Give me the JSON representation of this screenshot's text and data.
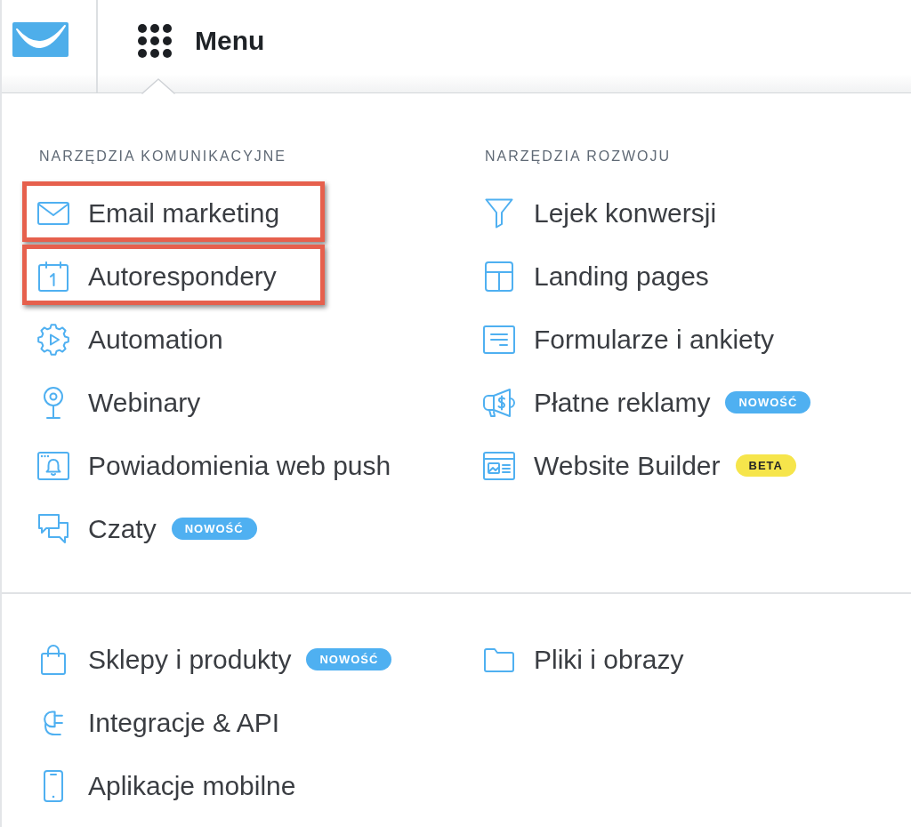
{
  "header": {
    "menu_label": "Menu"
  },
  "groups": [
    {
      "columns": [
        {
          "heading": "NARZĘDZIA KOMUNIKACYJNE",
          "items": [
            {
              "label": "Email marketing",
              "highlighted": true
            },
            {
              "label": "Autorespondery",
              "highlighted": true
            },
            {
              "label": "Automation",
              "highlighted": false
            },
            {
              "label": "Webinary",
              "highlighted": false
            },
            {
              "label": "Powiadomienia web push",
              "highlighted": false
            },
            {
              "label": "Czaty",
              "highlighted": false,
              "badge": {
                "text": "NOWOŚĆ",
                "kind": "new"
              }
            }
          ]
        },
        {
          "heading": "NARZĘDZIA ROZWOJU",
          "items": [
            {
              "label": "Lejek konwersji",
              "highlighted": false
            },
            {
              "label": "Landing pages",
              "highlighted": false
            },
            {
              "label": "Formularze i ankiety",
              "highlighted": false
            },
            {
              "label": "Płatne reklamy",
              "highlighted": false,
              "badge": {
                "text": "NOWOŚĆ",
                "kind": "new"
              }
            },
            {
              "label": "Website Builder",
              "highlighted": false,
              "badge": {
                "text": "BETA",
                "kind": "beta"
              }
            }
          ]
        }
      ]
    },
    {
      "columns": [
        {
          "items": [
            {
              "label": "Sklepy i produkty",
              "highlighted": false,
              "badge": {
                "text": "NOWOŚĆ",
                "kind": "new"
              }
            },
            {
              "label": "Integracje & API",
              "highlighted": false
            },
            {
              "label": "Aplikacje mobilne",
              "highlighted": false
            }
          ]
        },
        {
          "items": [
            {
              "label": "Pliki i obrazy",
              "highlighted": false
            }
          ]
        }
      ]
    }
  ]
}
